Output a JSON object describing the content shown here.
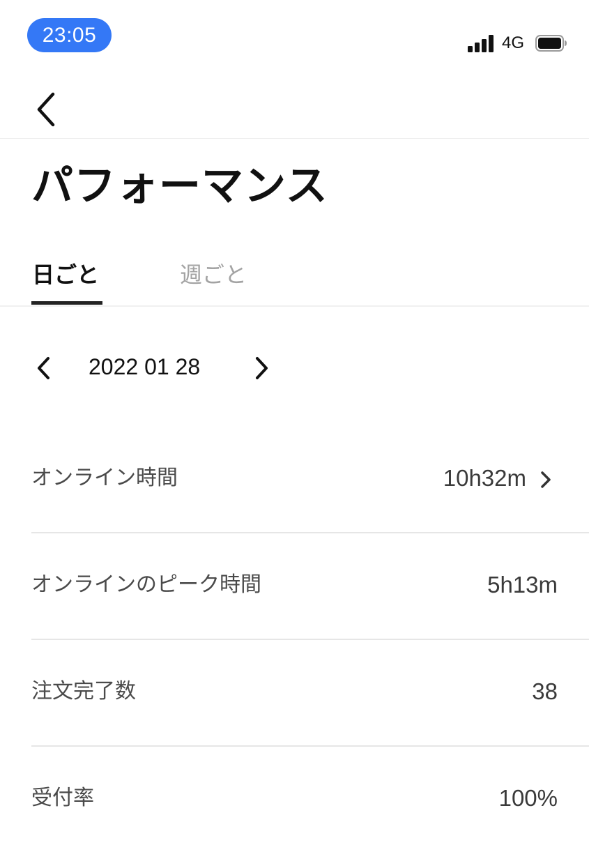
{
  "status_bar": {
    "time": "23:05",
    "network": "4G",
    "time_pill_color": "#3478f6",
    "icons": [
      "signal-icon",
      "battery-icon"
    ]
  },
  "nav": {
    "back_icon": "chevron-left-icon"
  },
  "title": "パフォーマンス",
  "tabs": [
    {
      "label": "日ごと",
      "active": true
    },
    {
      "label": "週ごと",
      "active": false
    }
  ],
  "date_nav": {
    "date": "2022 01 28",
    "prev_icon": "chevron-left-icon",
    "next_icon": "chevron-right-icon"
  },
  "stats": [
    {
      "label": "オンライン時間",
      "value": "10h32m",
      "has_chevron": true
    },
    {
      "label": "オンラインのピーク時間",
      "value": "5h13m",
      "has_chevron": false
    },
    {
      "label": "注文完了数",
      "value": "38",
      "has_chevron": false
    },
    {
      "label": "受付率",
      "value": "100%",
      "has_chevron": false
    }
  ]
}
